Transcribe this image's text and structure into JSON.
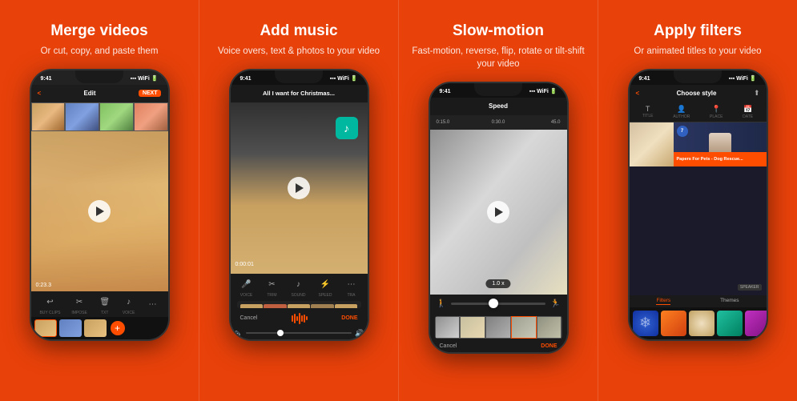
{
  "panels": [
    {
      "id": "merge",
      "title": "Merge videos",
      "subtitle": "Or cut, copy, and paste them",
      "phone": {
        "statusTime": "9:41",
        "topBar": {
          "back": "<",
          "center": "Edit",
          "next": "NEXT"
        },
        "timestamp": "0:23.3",
        "tools": [
          {
            "icon": "↩",
            "label": "BUY CLIPS"
          },
          {
            "icon": "✂",
            "label": "IMPOSE"
          },
          {
            "icon": "🗑",
            "label": "TXT"
          },
          {
            "icon": "♪",
            "label": "VOICE"
          },
          {
            "icon": "⋯",
            "label": ""
          }
        ]
      }
    },
    {
      "id": "music",
      "title": "Add music",
      "subtitle": "Voice overs, text & photos\nto your video",
      "phone": {
        "statusTime": "9:41",
        "topBar": {
          "song": "All I want for Christmas..."
        },
        "videoTime": "0:00:01",
        "tools": [
          {
            "icon": "🎤",
            "label": "VOICE"
          },
          {
            "icon": "✂",
            "label": "TRIM"
          },
          {
            "icon": "♪",
            "label": "SOUND"
          },
          {
            "icon": "⚡",
            "label": "SPEED"
          },
          {
            "icon": "⋯",
            "label": "TRA"
          }
        ],
        "cancel": "Cancel",
        "done": "DONE"
      }
    },
    {
      "id": "slowmotion",
      "title": "Slow-motion",
      "subtitle": "Fast-motion, reverse, flip, rotate\nor tilt-shift your video",
      "phone": {
        "statusTime": "9:41",
        "topBar": {
          "center": "Speed"
        },
        "markers": [
          "0:15.0",
          "0:30.0",
          "45.0"
        ],
        "speedLabel": "1.0 x",
        "cancel": "Cancel",
        "done": "DONE"
      }
    },
    {
      "id": "filters",
      "title": "Apply filters",
      "subtitle": "Or animated titles to your video",
      "phone": {
        "statusTime": "9:41",
        "topBar": {
          "back": "<",
          "center": "Choose style",
          "share": "⬆"
        },
        "tabs": [
          {
            "icon": "T",
            "label": "TITLE"
          },
          {
            "icon": "👤",
            "label": "AUTHOR"
          },
          {
            "icon": "📍",
            "label": "PLACE"
          },
          {
            "icon": "📅",
            "label": "DATE"
          }
        ],
        "lowerThirdText": "Papers For Pets - Dog Rescue...",
        "sections": [
          "Filters",
          "Themes"
        ],
        "activeSection": "Filters",
        "speakerLabel": "SPEAKER"
      }
    }
  ]
}
